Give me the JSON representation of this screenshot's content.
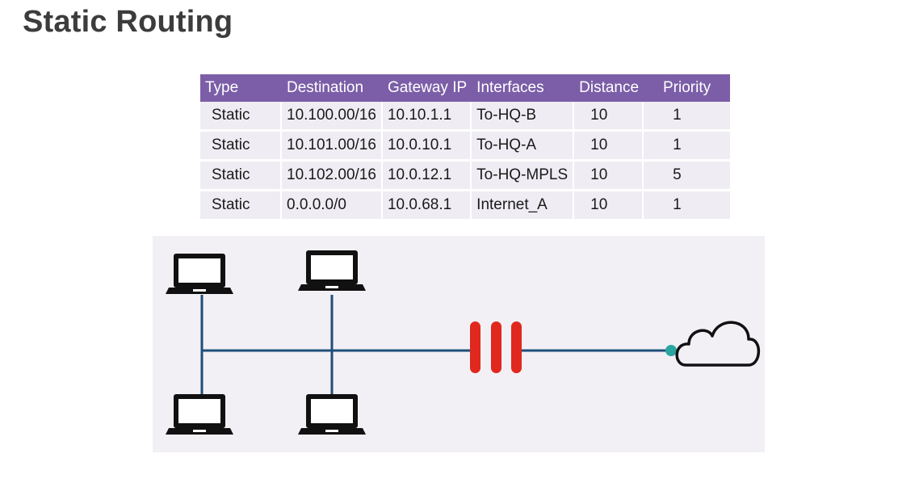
{
  "page": {
    "title": "Static Routing"
  },
  "table": {
    "headers": [
      "Type",
      "Destination",
      "Gateway IP",
      "Interfaces",
      "Distance",
      "Priority"
    ],
    "rows": [
      [
        "Static",
        "10.100.00/16",
        "10.10.1.1",
        "To-HQ-B",
        "10",
        "1"
      ],
      [
        "Static",
        "10.101.00/16",
        "10.0.10.1",
        "To-HQ-A",
        "10",
        "1"
      ],
      [
        "Static",
        "10.102.00/16",
        "10.0.12.1",
        "To-HQ-MPLS",
        "10",
        "5"
      ],
      [
        "Static",
        "0.0.0.0/0",
        "10.0.68.1",
        "Internet_A",
        "10",
        "1"
      ]
    ]
  },
  "diagram": {
    "icons": [
      "laptop-icon",
      "laptop-icon",
      "laptop-icon",
      "laptop-icon",
      "firewall-icon",
      "cloud-icon"
    ],
    "colors": {
      "link": "#1f4e79",
      "firewall": "#e0281e",
      "endpoint": "#2aa6a0",
      "laptop": "#111111",
      "background": "#f2f0f5",
      "header": "#7b5ea7"
    }
  }
}
